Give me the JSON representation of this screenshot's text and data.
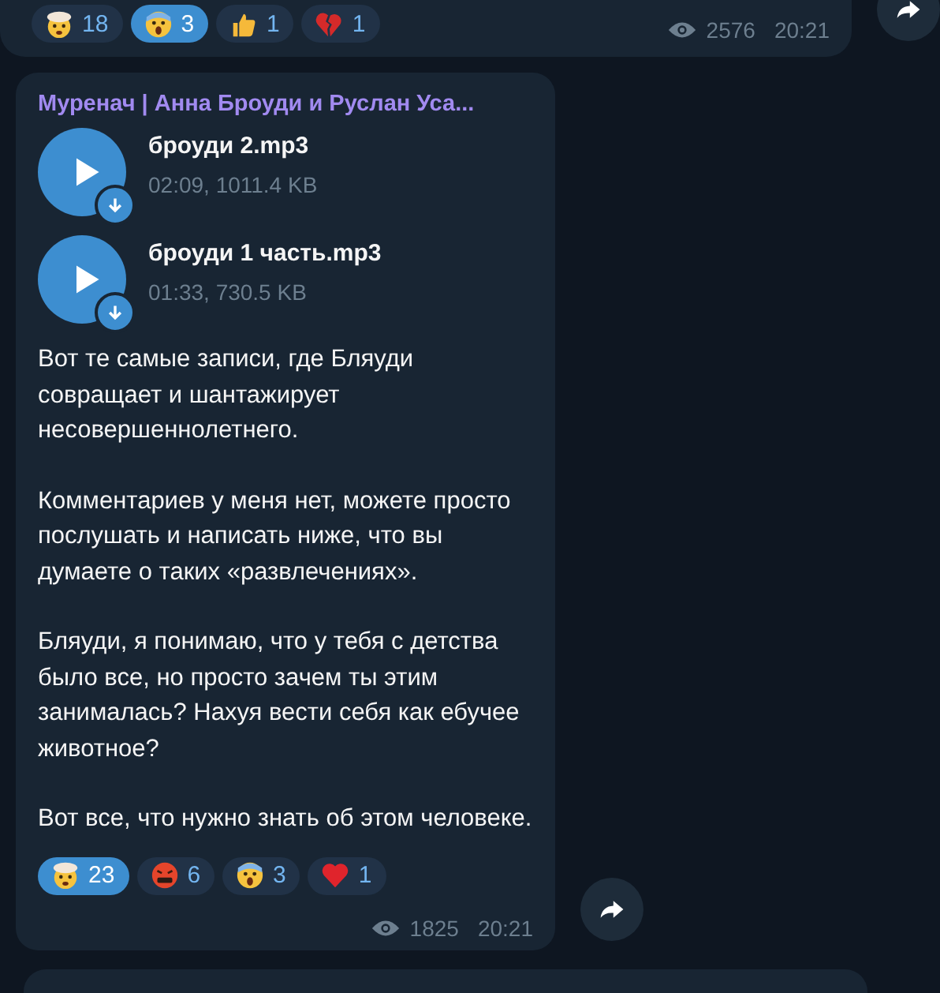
{
  "previous_message": {
    "reactions": [
      {
        "kind": "exploding-head",
        "count": "18",
        "selected": false
      },
      {
        "kind": "scream",
        "count": "3",
        "selected": true
      },
      {
        "kind": "thumbs-up",
        "count": "1",
        "selected": false
      },
      {
        "kind": "broken-heart",
        "count": "1",
        "selected": false
      }
    ],
    "views": "2576",
    "time": "20:21"
  },
  "message": {
    "sender": "Муренач | Анна Броуди и Руслан Уса...",
    "files": [
      {
        "name": "броуди 2.mp3",
        "meta": "02:09, 1011.4 KB"
      },
      {
        "name": "броуди 1 часть.mp3",
        "meta": "01:33, 730.5 KB"
      }
    ],
    "paragraphs": [
      "Вот те самые записи, где Бляуди совращает и шантажирует несовершеннолетнего.",
      "Комментариев у меня нет, можете просто послушать и написать ниже, что вы думаете о таких «развлечениях».",
      "Бляуди, я понимаю, что у тебя с детства было все, но просто зачем ты этим занималась? Нахуя вести себя как ебучее животное?",
      "Вот все, что нужно знать об этом человеке."
    ],
    "reactions": [
      {
        "kind": "exploding-head",
        "count": "23",
        "selected": true
      },
      {
        "kind": "cursing",
        "count": "6",
        "selected": false
      },
      {
        "kind": "scream",
        "count": "3",
        "selected": false
      },
      {
        "kind": "heart",
        "count": "1",
        "selected": false
      }
    ],
    "views": "1825",
    "time": "20:21"
  }
}
